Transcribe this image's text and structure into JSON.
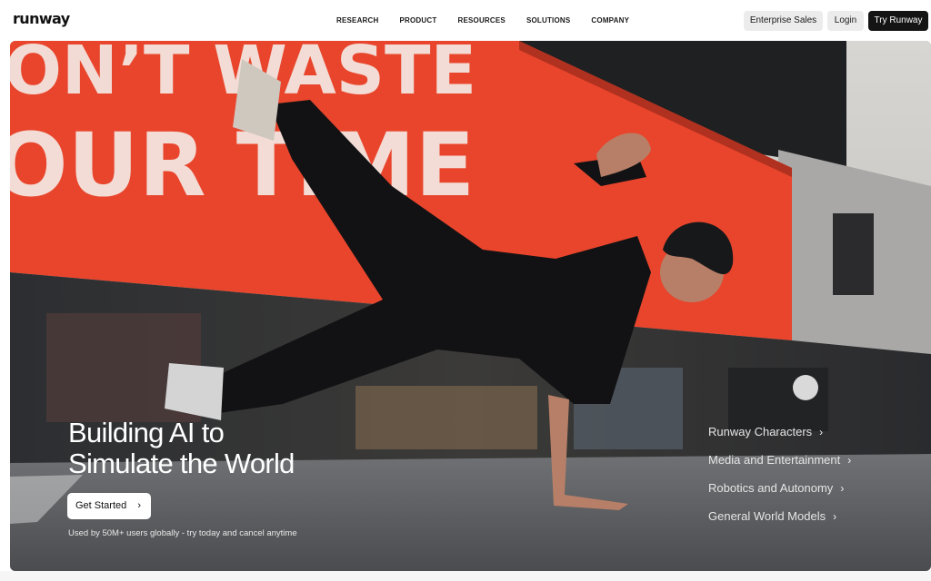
{
  "nav": {
    "logo": "runway",
    "menu": [
      "RESEARCH",
      "PRODUCT",
      "RESOURCES",
      "SOLUTIONS",
      "COMPANY"
    ],
    "enterprise_label": "Enterprise Sales",
    "login_label": "Login",
    "try_label": "Try Runway"
  },
  "hero": {
    "title_line1": "Building AI to",
    "title_line2": "Simulate the World",
    "cta_label": "Get Started",
    "cta_icon": "chevron-right-icon",
    "subtext": "Used by 50M+ users globally - try today and cancel anytime",
    "billboard_line1": "ON’T WASTE",
    "billboard_line2": "OUR TIME",
    "links": [
      {
        "label": "Runway Characters",
        "icon": "chevron-right-icon"
      },
      {
        "label": "Media and Entertainment",
        "icon": "chevron-right-icon"
      },
      {
        "label": "Robotics and Autonomy",
        "icon": "chevron-right-icon"
      },
      {
        "label": "General World Models",
        "icon": "chevron-right-icon"
      }
    ]
  },
  "colors": {
    "billboard_red": "#e8452c",
    "dark_button": "#141414",
    "light_button": "#ececec"
  }
}
